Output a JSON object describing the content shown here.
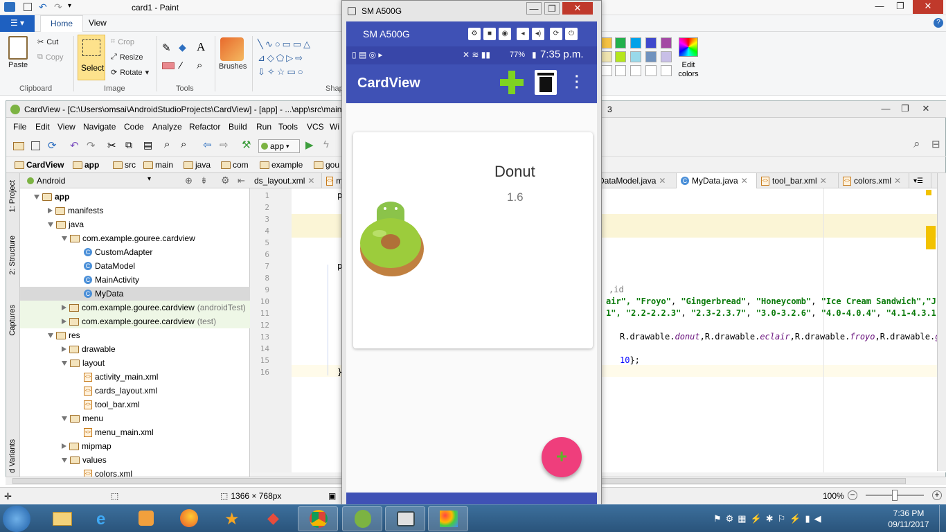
{
  "paint": {
    "title": "card1 - Paint",
    "tabs": [
      "Home",
      "View"
    ],
    "clipboard": {
      "paste": "Paste",
      "cut": "Cut",
      "copy": "Copy",
      "label": "Clipboard"
    },
    "image": {
      "select": "Select",
      "crop": "Crop",
      "resize": "Resize",
      "rotate": "Rotate",
      "label": "Image"
    },
    "tools_label": "Tools",
    "brushes": "Brushes",
    "shapes_label": "Shap",
    "edit_colors": [
      "Edit",
      "colors"
    ]
  },
  "android_studio": {
    "title": "CardView - [C:\\Users\\omsai\\AndroidStudioProjects\\CardView] - [app] - ...\\app\\src\\main",
    "title_fragment": "3",
    "menu": [
      "File",
      "Edit",
      "View",
      "Navigate",
      "Code",
      "Analyze",
      "Refactor",
      "Build",
      "Run",
      "Tools",
      "VCS",
      "Wi"
    ],
    "run_config": "app",
    "breadcrumb": [
      "CardView",
      "app",
      "src",
      "main",
      "java",
      "com",
      "example",
      "gou"
    ],
    "left_tabs": [
      "1: Project",
      "2: Structure",
      "Captures",
      "d Variants"
    ],
    "project_view": "Android",
    "tree": [
      {
        "label": "app",
        "depth": 0,
        "icon": "folder",
        "open": true,
        "bold": true
      },
      {
        "label": "manifests",
        "depth": 1,
        "icon": "folder",
        "open": false
      },
      {
        "label": "java",
        "depth": 1,
        "icon": "folder",
        "open": true
      },
      {
        "label": "com.example.gouree.cardview",
        "depth": 2,
        "icon": "package",
        "open": true
      },
      {
        "label": "CustomAdapter",
        "depth": 3,
        "icon": "class"
      },
      {
        "label": "DataModel",
        "depth": 3,
        "icon": "class"
      },
      {
        "label": "MainActivity",
        "depth": 3,
        "icon": "class"
      },
      {
        "label": "MyData",
        "depth": 3,
        "icon": "class",
        "selected": true
      },
      {
        "label": "com.example.gouree.cardview",
        "suffix": "(androidTest)",
        "depth": 2,
        "icon": "package",
        "open": false
      },
      {
        "label": "com.example.gouree.cardview",
        "suffix": "(test)",
        "depth": 2,
        "icon": "package",
        "open": false
      },
      {
        "label": "res",
        "depth": 1,
        "icon": "folder",
        "open": true
      },
      {
        "label": "drawable",
        "depth": 2,
        "icon": "folder",
        "open": false
      },
      {
        "label": "layout",
        "depth": 2,
        "icon": "folder",
        "open": true
      },
      {
        "label": "activity_main.xml",
        "depth": 3,
        "icon": "xml"
      },
      {
        "label": "cards_layout.xml",
        "depth": 3,
        "icon": "xml"
      },
      {
        "label": "tool_bar.xml",
        "depth": 3,
        "icon": "xml"
      },
      {
        "label": "menu",
        "depth": 2,
        "icon": "folder",
        "open": true
      },
      {
        "label": "menu_main.xml",
        "depth": 3,
        "icon": "xml"
      },
      {
        "label": "mipmap",
        "depth": 2,
        "icon": "folder",
        "open": false
      },
      {
        "label": "values",
        "depth": 2,
        "icon": "folder",
        "open": true
      },
      {
        "label": "colors.xml",
        "depth": 3,
        "icon": "xml"
      }
    ],
    "editor_tabs": [
      {
        "label": "ds_layout.xml",
        "active": false
      },
      {
        "label": "ma",
        "active": false
      },
      {
        "label": "DataModel.java",
        "active": false
      },
      {
        "label": "MyData.java",
        "active": true
      },
      {
        "label": "tool_bar.xml",
        "active": false
      },
      {
        "label": "colors.xml",
        "active": false
      }
    ],
    "line_numbers": [
      "1",
      "2",
      "3",
      "4",
      "5",
      "6",
      "7",
      "8",
      "9",
      "10",
      "11",
      "12",
      "13",
      "14",
      "15",
      "16"
    ],
    "code_fragments": {
      "l1": "pa",
      "l7": "pu",
      "l9": ",id",
      "l10": [
        "air\", ",
        "\"Froyo\"",
        ", ",
        "\"Gingerbread\"",
        ", ",
        "\"Honeycomb\"",
        ", ",
        "\"Ice Cream Sandwich\"",
        ",\"J"
      ],
      "l11": [
        "1\", ",
        "\"2.2-2.2.3\"",
        ", ",
        "\"2.3-2.3.7\"",
        ", ",
        "\"3.0-3.2.6\"",
        ", ",
        "\"4.0-4.0.4\"",
        ", ",
        "\"4.1-4.3.1"
      ],
      "l13": [
        "R.drawable.",
        "donut",
        ",R.drawable.",
        "eclair",
        ",R.drawable.",
        "froyo",
        ",R.drawable.",
        "gi"
      ],
      "l15": [
        "10",
        "};"
      ],
      "l16": "}"
    },
    "status": {
      "dimensions": "1366 × 768px",
      "zoom": "100%"
    }
  },
  "vysor": {
    "window_title": "SM A500G",
    "device_name": "SM A500G",
    "status": {
      "battery": "77%",
      "time": "7:35 p.m."
    },
    "app_title": "CardView",
    "card": {
      "name": "Donut",
      "version": "1.6"
    },
    "fab_symbol": "+"
  },
  "taskbar": {
    "time": "7:36 PM",
    "date": "09/11/2017"
  },
  "colors": {
    "accent": "#3f51b5",
    "fab": "#ef3e7c",
    "plus_green": "#5fb32a"
  }
}
